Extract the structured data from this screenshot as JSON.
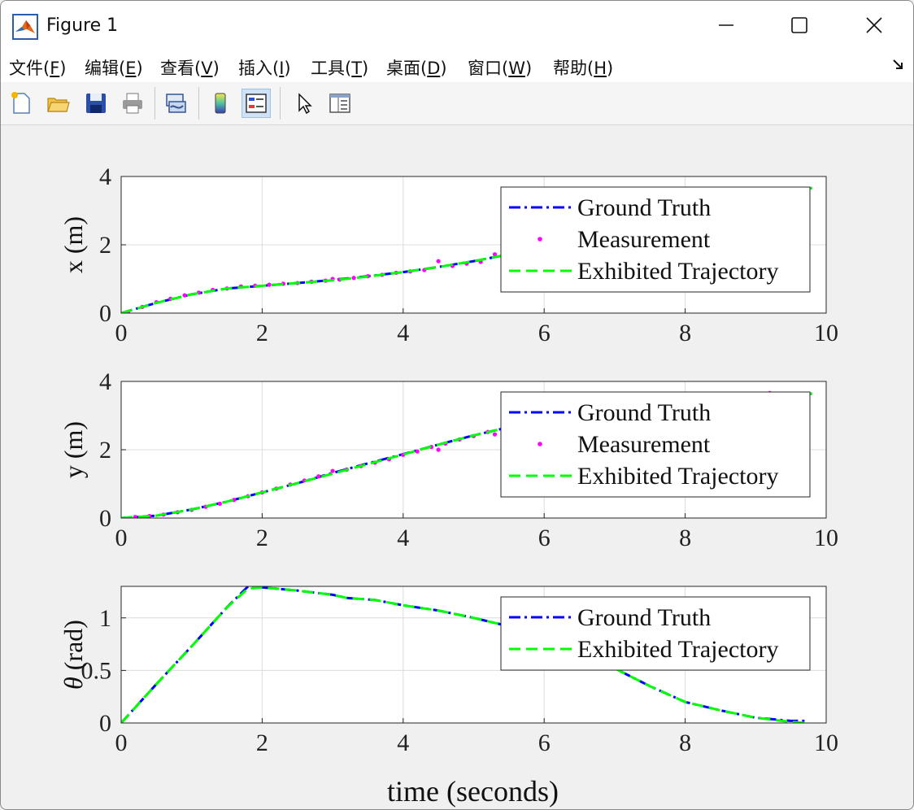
{
  "window": {
    "title": "Figure 1"
  },
  "menu": [
    {
      "label": "文件(",
      "key": "F",
      "end": ")"
    },
    {
      "label": "编辑(",
      "key": "E",
      "end": ")"
    },
    {
      "label": "查看(",
      "key": "V",
      "end": ")"
    },
    {
      "label": "插入(",
      "key": "I",
      "end": ")"
    },
    {
      "label": "工具(",
      "key": "T",
      "end": ")"
    },
    {
      "label": "桌面(",
      "key": "D",
      "end": ")"
    },
    {
      "label": "窗口(",
      "key": "W",
      "end": ")"
    },
    {
      "label": "帮助(",
      "key": "H",
      "end": ")"
    }
  ],
  "toolbar": {
    "icons": [
      "new-file-icon",
      "open-folder-icon",
      "save-icon",
      "print-icon",
      "link-plot-icon",
      "colorbar-icon",
      "legend-icon",
      "pointer-icon",
      "property-inspector-icon"
    ],
    "active": "legend-icon"
  },
  "chart_data": [
    {
      "type": "line",
      "ylabel": "x (m)",
      "xlim": [
        0,
        10
      ],
      "ylim": [
        0,
        4
      ],
      "xticks": [
        "0",
        "2",
        "4",
        "6",
        "8",
        "10"
      ],
      "yticks": [
        "0",
        "2",
        "4"
      ],
      "grid": true,
      "legend_position": "top-right",
      "legend": [
        "Ground Truth",
        "Measurement",
        "Exhibited Trajectory"
      ],
      "series": [
        {
          "name": "Ground Truth",
          "style": "dash-dot",
          "color": "#0000ff",
          "x": [
            0,
            0.5,
            1,
            1.5,
            2,
            2.5,
            3,
            3.5,
            4,
            4.5,
            5,
            5.5,
            6,
            6.5,
            7,
            7.5,
            8,
            8.5,
            9,
            9.5,
            9.8
          ],
          "y": [
            0,
            0.3,
            0.55,
            0.72,
            0.8,
            0.88,
            0.97,
            1.08,
            1.2,
            1.35,
            1.52,
            1.72,
            1.95,
            2.2,
            2.48,
            2.78,
            3.05,
            3.3,
            3.5,
            3.62,
            3.66
          ]
        },
        {
          "name": "Measurement",
          "style": "dots",
          "color": "#ff00ff",
          "x": [
            0.1,
            0.3,
            0.5,
            0.7,
            0.9,
            1.1,
            1.3,
            1.5,
            1.7,
            1.9,
            2.1,
            2.3,
            2.5,
            2.7,
            2.9,
            3.0,
            3.1,
            3.3,
            3.5,
            3.7,
            3.9,
            4.1,
            4.3,
            4.5,
            4.7,
            4.9,
            5.1,
            5.3
          ],
          "y": [
            0.04,
            0.18,
            0.32,
            0.42,
            0.52,
            0.6,
            0.68,
            0.72,
            0.78,
            0.8,
            0.83,
            0.86,
            0.88,
            0.92,
            0.95,
            1.0,
            0.98,
            1.03,
            1.08,
            1.12,
            1.18,
            1.22,
            1.26,
            1.52,
            1.38,
            1.45,
            1.5,
            1.72
          ]
        },
        {
          "name": "Exhibited Trajectory",
          "style": "dashed",
          "color": "#00ff00",
          "x": [
            0,
            0.5,
            1,
            1.5,
            2,
            2.5,
            3,
            3.5,
            4,
            4.5,
            5,
            5.5,
            6,
            6.5,
            7,
            7.5,
            8,
            8.5,
            9,
            9.5,
            9.8
          ],
          "y": [
            0,
            0.3,
            0.55,
            0.72,
            0.8,
            0.88,
            0.96,
            1.07,
            1.2,
            1.35,
            1.52,
            1.72,
            1.95,
            2.2,
            2.48,
            2.78,
            3.05,
            3.3,
            3.5,
            3.62,
            3.66
          ]
        }
      ]
    },
    {
      "type": "line",
      "ylabel": "y (m)",
      "xlim": [
        0,
        10
      ],
      "ylim": [
        0,
        4
      ],
      "xticks": [
        "0",
        "2",
        "4",
        "6",
        "8",
        "10"
      ],
      "yticks": [
        "0",
        "2",
        "4"
      ],
      "grid": true,
      "legend_position": "top-right",
      "legend": [
        "Ground Truth",
        "Measurement",
        "Exhibited Trajectory"
      ],
      "series": [
        {
          "name": "Ground Truth",
          "style": "dash-dot",
          "color": "#0000ff",
          "x": [
            0,
            0.5,
            1,
            1.5,
            2,
            2.5,
            3,
            3.5,
            4,
            4.5,
            5,
            5.5,
            6,
            6.5,
            7,
            7.5,
            8,
            8.5,
            9,
            9.5,
            9.8
          ],
          "y": [
            0,
            0.07,
            0.25,
            0.48,
            0.75,
            1.02,
            1.32,
            1.6,
            1.87,
            2.15,
            2.42,
            2.66,
            2.86,
            3.05,
            3.2,
            3.35,
            3.45,
            3.52,
            3.58,
            3.62,
            3.64
          ]
        },
        {
          "name": "Measurement",
          "style": "dots",
          "color": "#ff00ff",
          "x": [
            0.2,
            0.4,
            0.6,
            0.8,
            1.0,
            1.2,
            1.4,
            1.6,
            1.8,
            2.0,
            2.2,
            2.4,
            2.6,
            2.8,
            3.0,
            3.2,
            3.4,
            3.6,
            3.8,
            4.0,
            4.2,
            4.4,
            4.5,
            4.6,
            4.8,
            5.0,
            5.2,
            5.3,
            9.2
          ],
          "y": [
            0.03,
            0.06,
            0.1,
            0.17,
            0.24,
            0.33,
            0.42,
            0.53,
            0.64,
            0.75,
            0.86,
            0.98,
            1.1,
            1.22,
            1.38,
            1.42,
            1.52,
            1.62,
            1.72,
            1.85,
            1.95,
            2.08,
            2.0,
            2.18,
            2.3,
            2.4,
            2.52,
            2.45,
            3.66
          ]
        },
        {
          "name": "Exhibited Trajectory",
          "style": "dashed",
          "color": "#00ff00",
          "x": [
            0,
            0.5,
            1,
            1.5,
            2,
            2.5,
            3,
            3.5,
            4,
            4.5,
            5,
            5.5,
            6,
            6.5,
            7,
            7.5,
            8,
            8.5,
            9,
            9.5,
            9.8
          ],
          "y": [
            0,
            0.07,
            0.25,
            0.48,
            0.75,
            1.02,
            1.3,
            1.58,
            1.86,
            2.15,
            2.42,
            2.66,
            2.86,
            3.05,
            3.2,
            3.35,
            3.45,
            3.52,
            3.58,
            3.62,
            3.64
          ]
        }
      ]
    },
    {
      "type": "line",
      "ylabel_symbol": "θ",
      "ylabel_unit": "(rad)",
      "xlabel": "time (seconds)",
      "xlim": [
        0,
        10
      ],
      "ylim": [
        0,
        1.3
      ],
      "xticks": [
        "0",
        "2",
        "4",
        "6",
        "8",
        "10"
      ],
      "yticks": [
        "0",
        "0.5",
        "1"
      ],
      "grid": true,
      "legend_position": "top-right",
      "legend": [
        "Ground Truth",
        "Exhibited Trajectory"
      ],
      "series": [
        {
          "name": "Ground Truth",
          "style": "dash-dot",
          "color": "#0000ff",
          "x": [
            0,
            0.5,
            1,
            1.5,
            1.8,
            2.0,
            2.5,
            3.0,
            3.2,
            3.6,
            4.0,
            4.5,
            5.0,
            5.5,
            6.0,
            6.5,
            7.0,
            7.5,
            8.0,
            8.5,
            9.0,
            9.5,
            9.7
          ],
          "y": [
            0,
            0.37,
            0.73,
            1.1,
            1.3,
            1.29,
            1.26,
            1.22,
            1.19,
            1.17,
            1.12,
            1.07,
            1.0,
            0.92,
            0.83,
            0.68,
            0.52,
            0.35,
            0.2,
            0.12,
            0.05,
            0.02,
            0.02
          ]
        },
        {
          "name": "Exhibited Trajectory",
          "style": "dashed",
          "color": "#00ff00",
          "x": [
            0,
            0.5,
            1,
            1.5,
            1.8,
            2.0,
            2.5,
            3.0,
            3.2,
            3.6,
            4.0,
            4.5,
            5.0,
            5.5,
            6.0,
            6.5,
            7.0,
            7.5,
            8.0,
            8.5,
            9.0,
            9.5,
            9.7
          ],
          "y": [
            0,
            0.37,
            0.73,
            1.1,
            1.28,
            1.29,
            1.26,
            1.22,
            1.19,
            1.17,
            1.12,
            1.07,
            1.0,
            0.92,
            0.83,
            0.68,
            0.52,
            0.35,
            0.2,
            0.12,
            0.05,
            0.01,
            0.0
          ]
        }
      ]
    }
  ]
}
